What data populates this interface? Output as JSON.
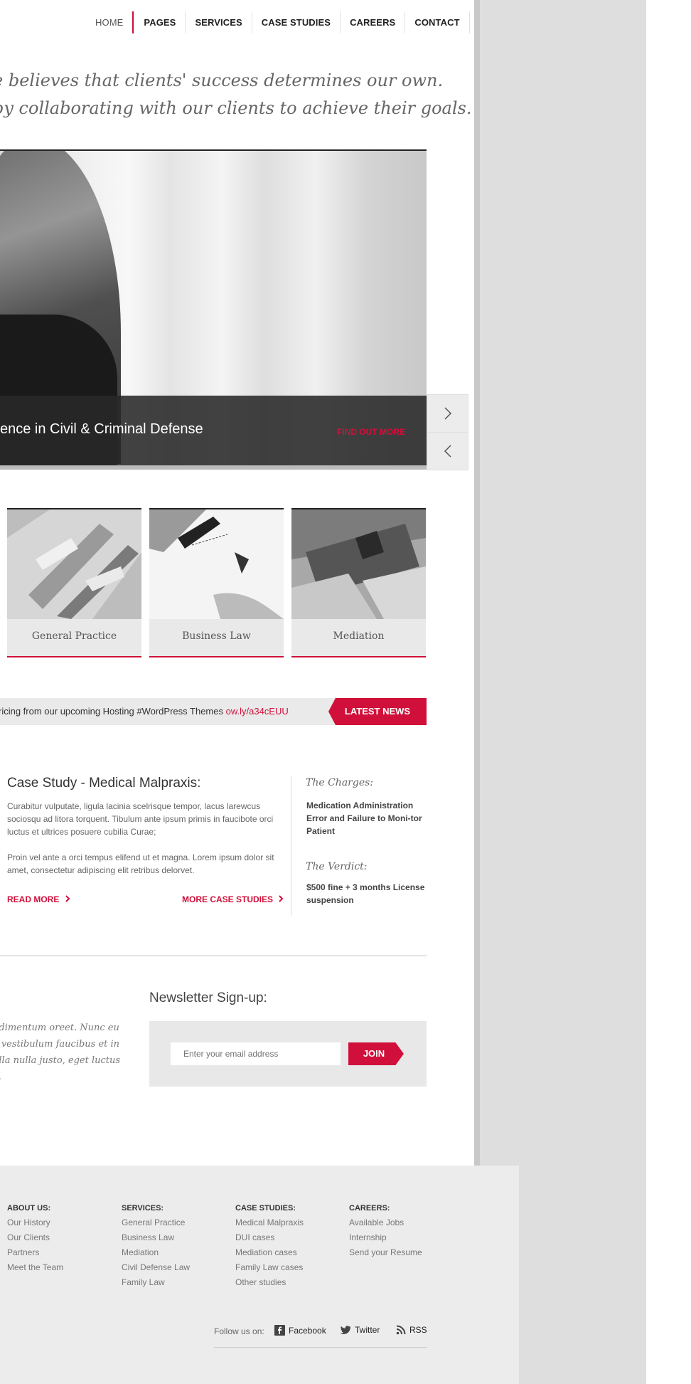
{
  "nav": {
    "items": [
      {
        "label": "HOME"
      },
      {
        "label": "PAGES"
      },
      {
        "label": "SERVICES"
      },
      {
        "label": "CASE STUDIES"
      },
      {
        "label": "CAREERS"
      },
      {
        "label": "CONTACT"
      }
    ]
  },
  "tagline": {
    "line1": "e believes that clients' success determines our own.",
    "line2": "by collaborating with our clients to achieve their goals."
  },
  "slider": {
    "caption": "ence in Civil & Criminal Defense",
    "cta": "FIND OUT MORE"
  },
  "practices": [
    {
      "label": "General Practice"
    },
    {
      "label": "Business Law"
    },
    {
      "label": "Mediation"
    }
  ],
  "ticker": {
    "text": "ricing from our upcoming Hosting #WordPress Themes ",
    "link": "ow.ly/a34cEUU",
    "badge": "LATEST NEWS"
  },
  "case": {
    "title": "Case Study - Medical Malpraxis:",
    "p1": "Curabitur vulputate, ligula lacinia scelrisque tempor, lacus larewcus sociosqu ad litora torquent. Tibulum ante ipsum primis in faucibote orci luctus et ultrices posuere cubilia Curae;",
    "p2": "Proin vel ante a orci tempus elifend ut et magna. Lorem ipsum dolor sit amet, consectetur adipiscing elit retribus delorvet.",
    "read_more": "READ MORE",
    "more_studies": "MORE CASE STUDIES",
    "charges_h": "The Charges:",
    "charges_t": "Medication Administration Error and Failure to Moni-tor Patient",
    "verdict_h": "The Verdict:",
    "verdict_t": "$500 fine + 3 months License suspension"
  },
  "quote": {
    "text": "ndimentum oreet. Nunc eu e vestibulum faucibus et in ulla nulla justo, eget luctus e."
  },
  "newsletter": {
    "title": "Newsletter Sign-up:",
    "placeholder": "Enter your email address",
    "button": "JOIN"
  },
  "footer": {
    "columns": [
      {
        "heading": "ABOUT US:",
        "items": [
          "Our History",
          "Our Clients",
          "Partners",
          "Meet the Team"
        ]
      },
      {
        "heading": "SERVICES:",
        "items": [
          "General Practice",
          "Business Law",
          "Mediation",
          "Civil Defense Law",
          "Family Law"
        ]
      },
      {
        "heading": "CASE STUDIES:",
        "items": [
          "Medical Malpraxis",
          "DUI cases",
          "Mediation cases",
          "Family Law cases",
          "Other studies"
        ]
      },
      {
        "heading": "CAREERS:",
        "items": [
          "Available Jobs",
          "Internship",
          "Send your Resume"
        ]
      }
    ],
    "follow": "Follow us on:",
    "social": [
      {
        "label": "Facebook",
        "icon": "facebook-icon"
      },
      {
        "label": "Twitter",
        "icon": "twitter-icon"
      },
      {
        "label": "RSS",
        "icon": "rss-icon"
      }
    ]
  },
  "colors": {
    "accent": "#d0103a",
    "dark": "#222222",
    "panel": "#eaeaea"
  }
}
